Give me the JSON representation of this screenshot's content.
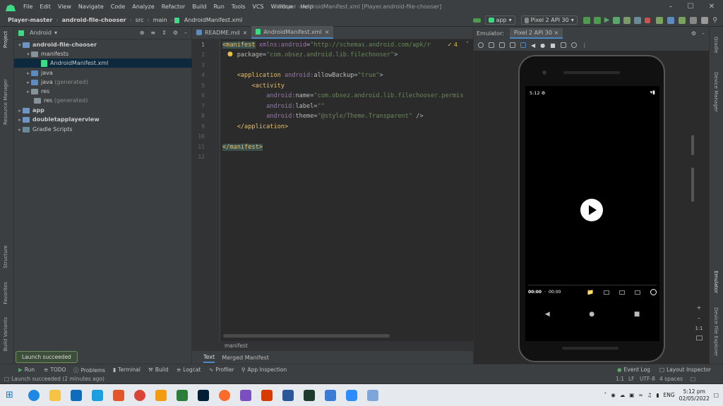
{
  "menu": [
    "File",
    "Edit",
    "View",
    "Navigate",
    "Code",
    "Analyze",
    "Refactor",
    "Build",
    "Run",
    "Tools",
    "VCS",
    "Window",
    "Help"
  ],
  "window_title": "Player - AndroidManifest.xml [Player.android-file-chooser]",
  "breadcrumb": [
    "Player-master",
    "android-file-chooser",
    "src",
    "main",
    "AndroidManifest.xml"
  ],
  "run_config": "app",
  "device": "Pixel 2 API 30",
  "project": {
    "view": "Android",
    "tree": [
      {
        "label": "android-file-chooser",
        "extra": ""
      },
      {
        "label": "manifests",
        "extra": ""
      },
      {
        "label": "AndroidManifest.xml",
        "extra": ""
      },
      {
        "label": "java",
        "extra": ""
      },
      {
        "label": "java",
        "extra": "(generated)"
      },
      {
        "label": "res",
        "extra": ""
      },
      {
        "label": "res",
        "extra": "(generated)"
      },
      {
        "label": "app",
        "extra": ""
      },
      {
        "label": "doubletapplayerview",
        "extra": ""
      },
      {
        "label": "Gradle Scripts",
        "extra": ""
      }
    ]
  },
  "editor": {
    "tabs": [
      "README.md",
      "AndroidManifest.xml"
    ],
    "lines": [
      "1",
      "2",
      "3",
      "4",
      "5",
      "6",
      "7",
      "8",
      "9",
      "10",
      "11",
      "12"
    ],
    "warnings": "4",
    "footer": "manifest",
    "mode_tabs": [
      "Text",
      "Merged Manifest"
    ]
  },
  "emulator": {
    "label": "Emulator:",
    "tab": "Pixel 2 API 30",
    "time": "5:12",
    "pos": "00:00",
    "dur": "00:00",
    "ratio": "1:1"
  },
  "left_tabs": [
    "Project",
    "Resource Manager",
    "Structure",
    "Favorites",
    "Build Variants"
  ],
  "right_tabs": [
    "Gradle",
    "Device Manager",
    "Emulator",
    "Device File Explorer"
  ],
  "bottom_tools": [
    "Run",
    "TODO",
    "Problems",
    "Terminal",
    "Build",
    "Logcat",
    "Profiler",
    "App Inspection"
  ],
  "bottom_right": [
    "Event Log",
    "Layout Inspector"
  ],
  "status": {
    "message": "Launch succeeded (2 minutes ago)",
    "toast": "Launch succeeded",
    "pos": "1:1",
    "lf": "LF",
    "enc": "UTF-8",
    "indent": "4 spaces"
  },
  "taskbar": {
    "lang": "ENG",
    "time": "5:12 pm",
    "date": "02/05/2022"
  }
}
